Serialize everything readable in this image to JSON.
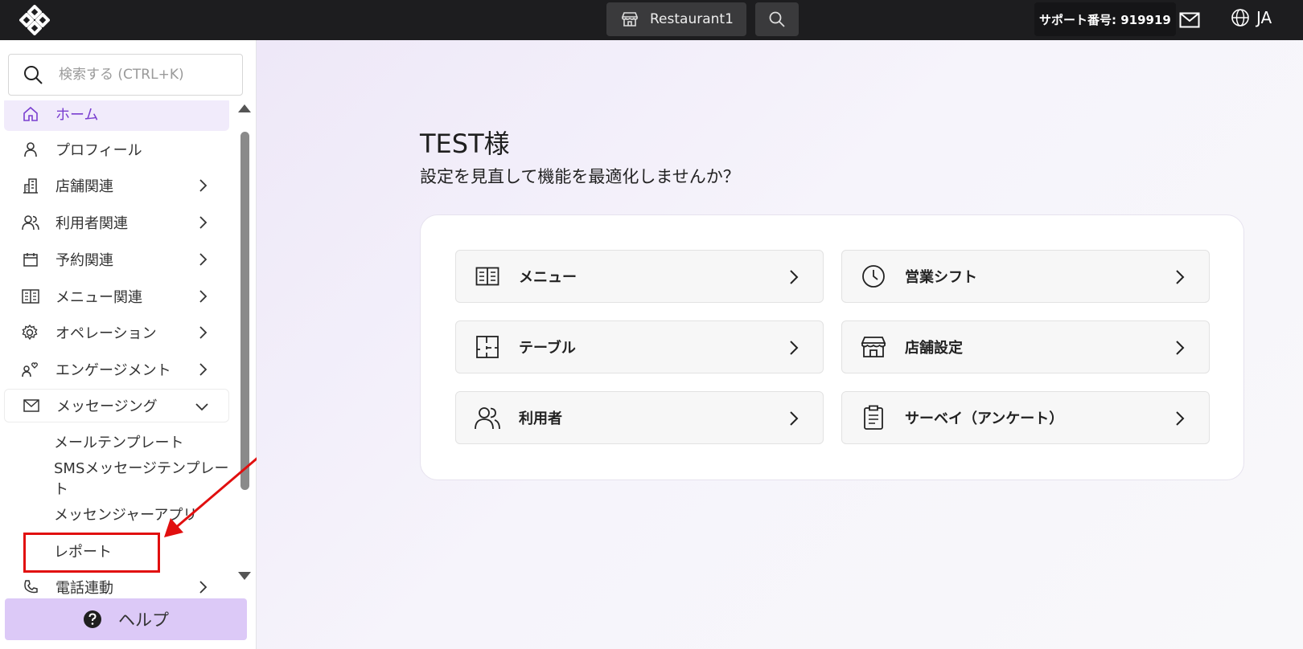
{
  "topbar": {
    "store_name": "Restaurant1",
    "support_text": "サポート番号: 919919",
    "language": "JA"
  },
  "sidebar": {
    "search_placeholder": "検索する (CTRL+K)",
    "items": [
      {
        "label": "ホーム",
        "icon": "home-icon",
        "active": true
      },
      {
        "label": "プロフィール",
        "icon": "user-icon"
      },
      {
        "label": "店舗関連",
        "icon": "building-icon"
      },
      {
        "label": "利用者関連",
        "icon": "users-icon"
      },
      {
        "label": "予約関連",
        "icon": "calendar-icon"
      },
      {
        "label": "メニュー関連",
        "icon": "menu-book-icon"
      },
      {
        "label": "オペレーション",
        "icon": "gear-icon"
      },
      {
        "label": "エンゲージメント",
        "icon": "engagement-icon"
      },
      {
        "label": "メッセージング",
        "icon": "mail-icon",
        "expanded": true
      },
      {
        "label": "電話連動",
        "icon": "phone-icon"
      }
    ],
    "messaging_sub": [
      "メールテンプレート",
      "SMSメッセージテンプレート",
      "メッセンジャーアプリ",
      "レポート"
    ],
    "help_label": "ヘルプ"
  },
  "main": {
    "greeting": "TEST様",
    "subtitle": "設定を見直して機能を最適化しませんか？",
    "tiles": [
      {
        "label": "メニュー",
        "icon": "menu-book-icon"
      },
      {
        "label": "営業シフト",
        "icon": "clock-icon"
      },
      {
        "label": "テーブル",
        "icon": "table-layout-icon"
      },
      {
        "label": "店舗設定",
        "icon": "storefront-icon"
      },
      {
        "label": "利用者",
        "icon": "users-icon"
      },
      {
        "label": "サーベイ（アンケート）",
        "icon": "clipboard-icon"
      }
    ]
  },
  "colors": {
    "topbar_bg": "#1d1d1f",
    "accent_purple": "#7a3fd0",
    "help_bg": "#dcc9f7",
    "annotation_red": "#e10f0f"
  }
}
